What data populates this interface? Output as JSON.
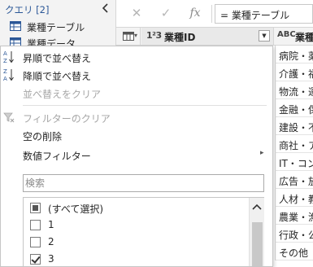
{
  "query_pane": {
    "title": "クエリ [2]",
    "items": [
      {
        "label": "業種テーブル"
      },
      {
        "label": "業種データ"
      }
    ]
  },
  "formula_bar": {
    "cancel_glyph": "✕",
    "confirm_glyph": "✓",
    "fx_label": "fx",
    "formula": "= 業種テーブル"
  },
  "columns": [
    {
      "type": "1²3",
      "name": "業種ID"
    },
    {
      "type": "ABC",
      "name": "業種"
    }
  ],
  "column2_cells": [
    "病院・薬",
    "介護・福",
    "物流・運",
    "金融・保",
    "建設・不",
    "商社・ア",
    "IT・コンピ",
    "広告・放",
    "人材・教",
    "農業・漁",
    "行政・公",
    "その他"
  ],
  "filter_menu": {
    "items": [
      {
        "label": "昇順で並べ替え",
        "icon": "sort-ascending-icon"
      },
      {
        "label": "降順で並べ替え",
        "icon": "sort-descending-icon"
      },
      {
        "label": "並べ替えをクリア",
        "disabled": true
      },
      {
        "label": "フィルターのクリア",
        "icon": "clear-filter-icon",
        "disabled": true
      },
      {
        "label": "空の削除"
      },
      {
        "label": "数値フィルター",
        "has_submenu": true
      }
    ],
    "search_placeholder": "検索",
    "values": [
      {
        "label": "(すべて選択)",
        "state": "partial"
      },
      {
        "label": "1",
        "state": "unchecked"
      },
      {
        "label": "2",
        "state": "unchecked"
      },
      {
        "label": "3",
        "state": "checked"
      }
    ]
  },
  "colors": {
    "accent": "#2b5797",
    "disabled_text": "#a6a6a6",
    "pane_bg": "#f3f3f3"
  }
}
